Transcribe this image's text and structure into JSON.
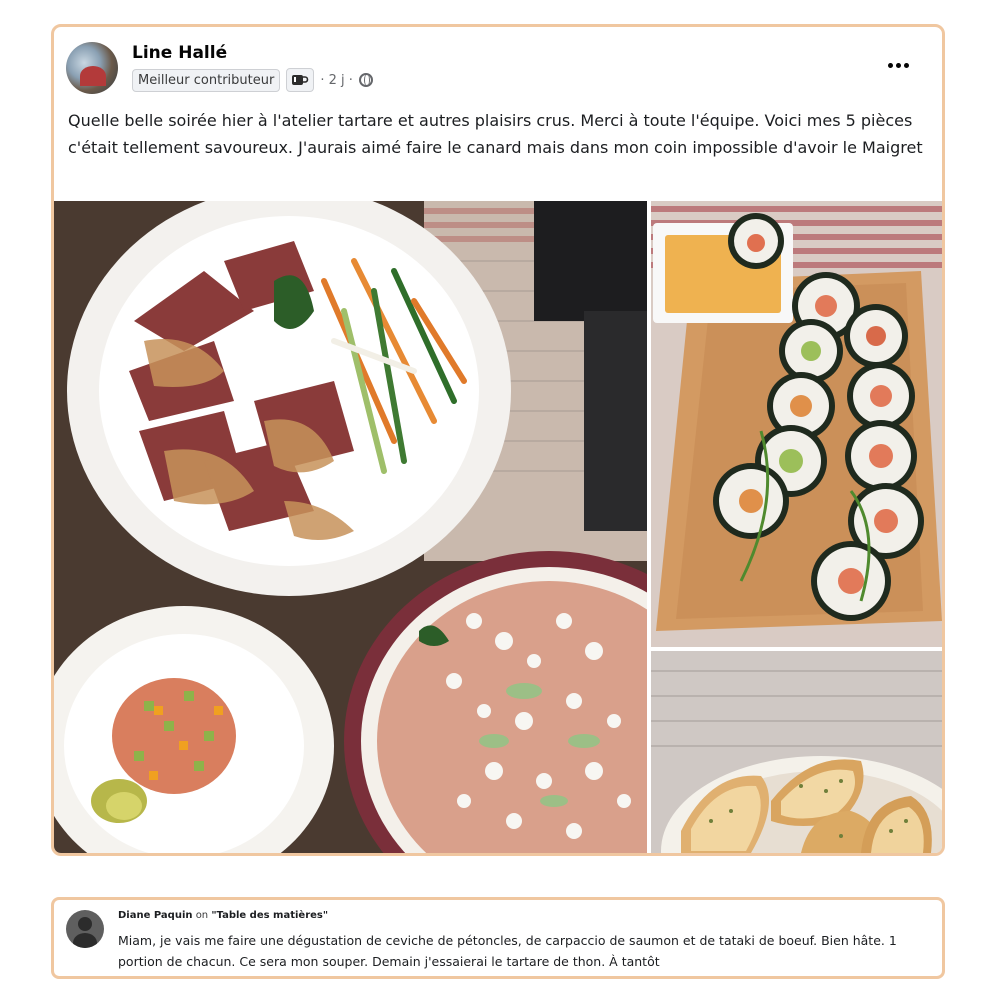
{
  "post": {
    "author": "Line Hallé",
    "badge": "Meilleur contributeur",
    "time": "· 2 j ·",
    "body": "Quelle belle soirée hier à l'atelier tartare et autres plaisirs crus. Merci à toute l'équipe. Voici mes 5 pièces  c'était tellement savoureux. J'aurais aimé faire le canard mais dans mon coin impossible d'avoir le Maigret"
  },
  "comment": {
    "author": "Diane Paquin",
    "on": "on",
    "topic": "\"Table des matières\"",
    "body": "Miam, je vais me faire une dégustation de ceviche de pétoncles, de carpaccio de saumon et de tataki de boeuf. Bien hâte. 1 portion de chacun. Ce sera mon souper. Demain j'essaierai le tartare de thon. À tantôt"
  },
  "icons": {
    "more": "more-options-icon",
    "audience": "globe-icon",
    "badge_icon": "coffee-cup-icon"
  },
  "colors": {
    "card_border": "#f0c7a0",
    "text": "#1c1e21",
    "meta": "#65676b"
  }
}
